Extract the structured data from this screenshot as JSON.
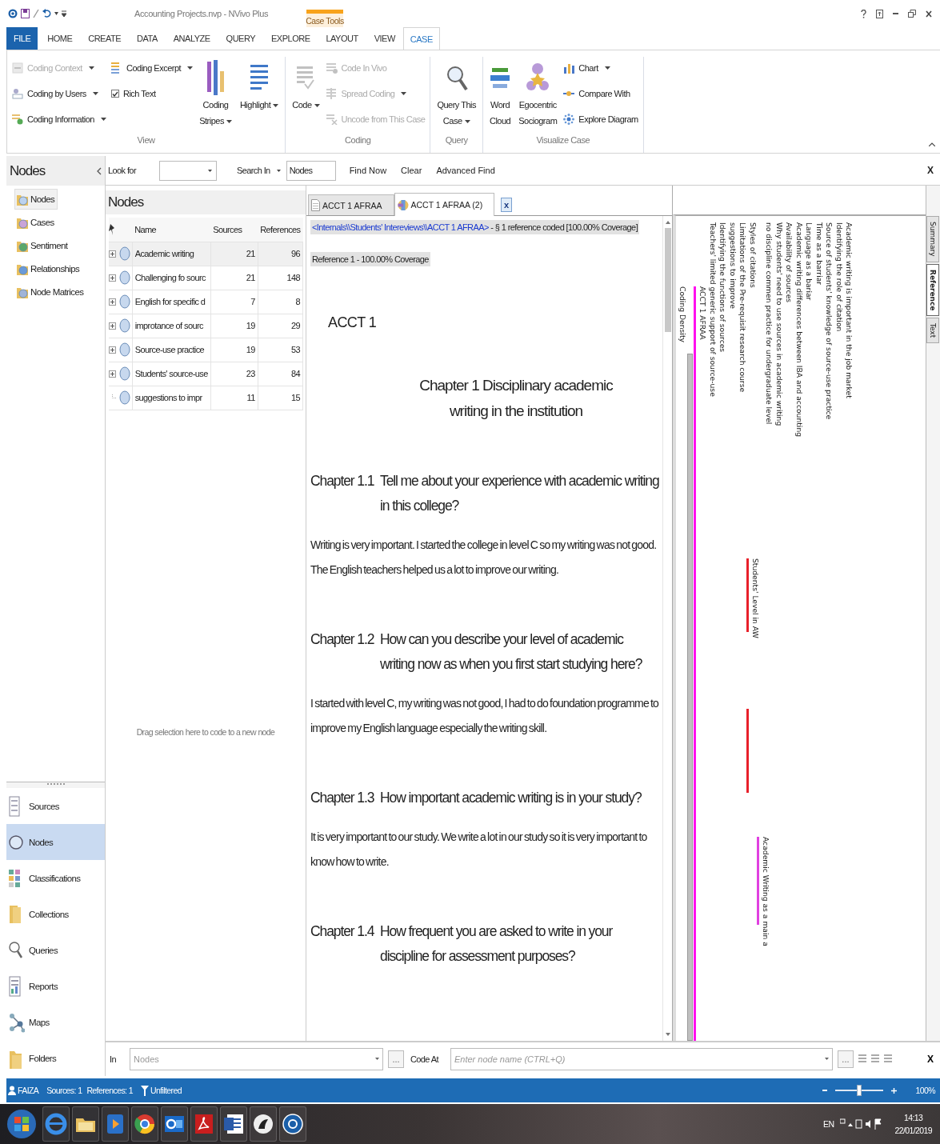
{
  "title_bar": {
    "title": "Accounting Projects.nvp - NVivo Plus",
    "context_tab": "Case Tools"
  },
  "ribbon_tabs": [
    {
      "label": "FILE",
      "kind": "file",
      "selected": false
    },
    {
      "label": "HOME",
      "kind": "tab",
      "selected": false
    },
    {
      "label": "CREATE",
      "kind": "tab",
      "selected": false
    },
    {
      "label": "DATA",
      "kind": "tab",
      "selected": false
    },
    {
      "label": "ANALYZE",
      "kind": "tab",
      "selected": false
    },
    {
      "label": "QUERY",
      "kind": "tab",
      "selected": false
    },
    {
      "label": "EXPLORE",
      "kind": "tab",
      "selected": false
    },
    {
      "label": "LAYOUT",
      "kind": "tab",
      "selected": false
    },
    {
      "label": "VIEW",
      "kind": "tab",
      "selected": false
    },
    {
      "label": "CASE",
      "kind": "tab",
      "selected": true
    }
  ],
  "ribbon_groups": [
    {
      "label": "View",
      "items": [
        {
          "kind": "small",
          "label": "Coding Context",
          "disabled": true,
          "dropdown": true
        },
        {
          "kind": "small",
          "label": "Coding by Users",
          "disabled": false,
          "dropdown": true
        },
        {
          "kind": "small",
          "label": "Coding Information",
          "disabled": false,
          "dropdown": true
        },
        {
          "kind": "small",
          "label": "Coding Excerpt",
          "disabled": false,
          "dropdown": true
        },
        {
          "kind": "check",
          "label": "Rich Text",
          "checked": true
        },
        {
          "kind": "large",
          "lines": [
            "Coding",
            "Stripes"
          ],
          "disabled": false,
          "dropdown": true
        },
        {
          "kind": "large",
          "lines": [
            "Highlight"
          ],
          "disabled": false,
          "dropdown": true
        }
      ]
    },
    {
      "label": "Coding",
      "items": [
        {
          "kind": "large",
          "lines": [
            "Code"
          ],
          "disabled": true,
          "dropdown": true
        },
        {
          "kind": "small",
          "label": "Code In Vivo",
          "disabled": true,
          "dropdown": false
        },
        {
          "kind": "small",
          "label": "Spread Coding",
          "disabled": true,
          "dropdown": true
        },
        {
          "kind": "small",
          "label": "Uncode from This Case",
          "disabled": true,
          "dropdown": false
        }
      ]
    },
    {
      "label": "Query",
      "items": [
        {
          "kind": "large",
          "lines": [
            "Query This",
            "Case"
          ],
          "disabled": false,
          "dropdown": true
        }
      ]
    },
    {
      "label": "Visualize Case",
      "items": [
        {
          "kind": "large",
          "lines": [
            "Word",
            "Cloud"
          ],
          "disabled": false,
          "dropdown": false
        },
        {
          "kind": "large",
          "lines": [
            "Egocentric",
            "Sociogram"
          ],
          "disabled": false,
          "dropdown": false
        },
        {
          "kind": "small",
          "label": "Chart",
          "disabled": false,
          "dropdown": true
        },
        {
          "kind": "small",
          "label": "Compare With",
          "disabled": false,
          "dropdown": false
        },
        {
          "kind": "small",
          "label": "Explore Diagram",
          "disabled": false,
          "dropdown": false
        }
      ]
    }
  ],
  "find_bar": {
    "look_for_label": "Look for",
    "search_in_label": "Search In",
    "search_in_value": "Nodes",
    "buttons": [
      "Find Now",
      "Clear",
      "Advanced Find"
    ],
    "close": "X"
  },
  "navigation": {
    "title": "Nodes",
    "items": [
      {
        "label": "Nodes",
        "selected": true
      },
      {
        "label": "Cases",
        "selected": false
      },
      {
        "label": "Sentiment",
        "selected": false
      },
      {
        "label": "Relationships",
        "selected": false
      },
      {
        "label": "Node Matrices",
        "selected": false
      }
    ],
    "views": [
      {
        "label": "Sources",
        "selected": false
      },
      {
        "label": "Nodes",
        "selected": true
      },
      {
        "label": "Classifications",
        "selected": false
      },
      {
        "label": "Collections",
        "selected": false
      },
      {
        "label": "Queries",
        "selected": false
      },
      {
        "label": "Reports",
        "selected": false
      },
      {
        "label": "Maps",
        "selected": false
      },
      {
        "label": "Folders",
        "selected": false
      }
    ]
  },
  "node_list": {
    "title": "Nodes",
    "columns": [
      "Name",
      "Sources",
      "References"
    ],
    "rows": [
      {
        "name": "Academic writing",
        "sources": "21",
        "references": "96",
        "expandable": true,
        "selected": true
      },
      {
        "name": "Challenging fo sourc",
        "sources": "21",
        "references": "148",
        "expandable": true,
        "selected": false
      },
      {
        "name": "English for specific d",
        "sources": "7",
        "references": "8",
        "expandable": true,
        "selected": false
      },
      {
        "name": "improtance of sourc",
        "sources": "19",
        "references": "29",
        "expandable": true,
        "selected": false
      },
      {
        "name": "Source-use practice",
        "sources": "19",
        "references": "53",
        "expandable": true,
        "selected": false
      },
      {
        "name": "Students' source-use",
        "sources": "23",
        "references": "84",
        "expandable": true,
        "selected": false
      },
      {
        "name": "suggestions to impr",
        "sources": "11",
        "references": "15",
        "expandable": false,
        "selected": false
      }
    ],
    "hint": "Drag selection here to code to a new node"
  },
  "document": {
    "tabs": [
      {
        "label": "ACCT 1 AFRAA",
        "selected": false
      },
      {
        "label": "ACCT 1 AFRAA (2)",
        "selected": true
      }
    ],
    "close": "x",
    "source_link": "<Internals\\\\Students' Intereviews\\\\ACCT 1 AFRAA>",
    "source_info": "- § 1 reference coded  [100.00% Coverage]",
    "reference": "Reference 1 - 100.00% Coverage",
    "blocks": [
      {
        "kind": "title",
        "text": "ACCT 1"
      },
      {
        "kind": "heading",
        "text": "Chapter 1 Disciplinary academic writing in the institution"
      },
      {
        "kind": "question",
        "number": "Chapter 1.1",
        "text": "Tell me about your experience with academic writing in this college?"
      },
      {
        "kind": "answer",
        "text": "Writing is very important. I started the college in level C so my writing was not good. The English teachers helped us a lot to improve our writing."
      },
      {
        "kind": "question",
        "number": "Chapter 1.2",
        "text": "How can you describe your level of academic writing now as when you first start studying here?"
      },
      {
        "kind": "answer",
        "text": "I started with level C, my writing was not good, I had to do foundation programme to improve my English language especially the writing skill."
      },
      {
        "kind": "question",
        "number": "Chapter 1.3",
        "text": "How important academic writing is in your study?"
      },
      {
        "kind": "answer",
        "text": "It is very important to our study. We write a lot in our study so it is very important to know how to write."
      },
      {
        "kind": "question",
        "number": "Chapter 1.4",
        "text": "How frequent you are asked to write in your discipline for assessment purposes?"
      }
    ]
  },
  "coding_stripes": {
    "label_groups": [
      [
        "Academic writing is important in the job market",
        "Identifying the role of citation",
        "Source of students' knowledge of source-use practice",
        "Time as a barriar",
        "Language as a bariar",
        "Academic writing differences between IBA and accounting",
        "Availability of sources",
        "Why students' need to use sources in academic writing",
        "no discipline commen practice for undergraduate level"
      ],
      [
        "Styles of citations",
        "Limitations of the Pre-requisit research course",
        "suggestions to improve",
        "Identifying the functions of sources",
        "Teachers' limited generic support of source-use"
      ]
    ],
    "stripes": [
      {
        "label": "ACCT 1 AFRAA",
        "color": "#ff10ee"
      },
      {
        "label": "Coding Density",
        "color": "#c0c0c0"
      }
    ],
    "segments": [
      {
        "label": "Students' Level in AW",
        "color": "#e8202a"
      },
      {
        "color": "#e8202a"
      },
      {
        "label": "Academic Writing as a main a",
        "color": "#e040e0"
      }
    ]
  },
  "side_tabs": [
    {
      "label": "Summary",
      "selected": false
    },
    {
      "label": "Reference",
      "selected": true
    },
    {
      "label": "Text",
      "selected": false
    }
  ],
  "code_bar": {
    "in_label": "In",
    "in_placeholder": "Nodes",
    "browse": "...",
    "code_at_label": "Code At",
    "node_placeholder": "Enter node name (CTRL+Q)",
    "browse_2": "...",
    "close": "X"
  },
  "status_bar": {
    "user": "FAIZA",
    "sources": "Sources: 1",
    "references": "References: 1",
    "filter": "Unfiltered",
    "zoom": {
      "level": 0.5
    },
    "zoom_reading": "100%"
  },
  "taskbar": {
    "language": "EN",
    "time": "14:13",
    "date": "22/01/2019"
  }
}
